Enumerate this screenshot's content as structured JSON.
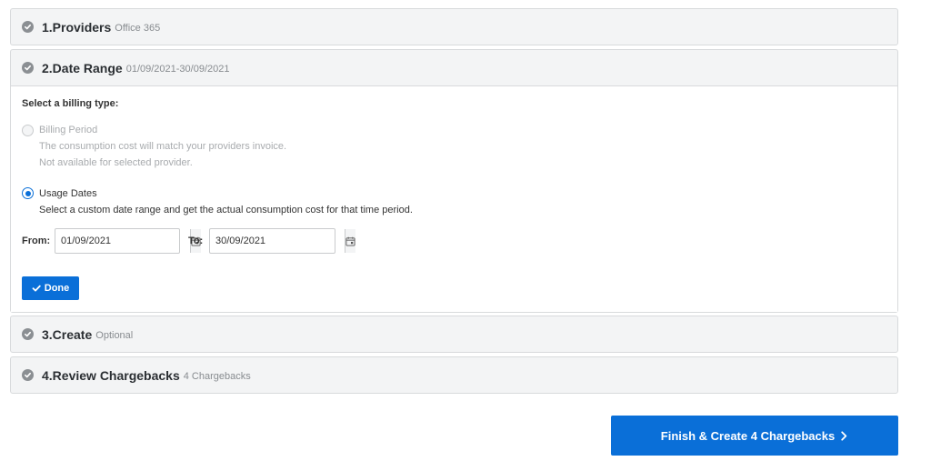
{
  "steps": [
    {
      "title": "1.Providers",
      "subtitle": "Office 365"
    },
    {
      "title": "2.Date Range",
      "subtitle": "01/09/2021-30/09/2021"
    },
    {
      "title": "3.Create",
      "subtitle": "Optional"
    },
    {
      "title": "4.Review Chargebacks",
      "subtitle": "4 Chargebacks"
    }
  ],
  "date_range": {
    "billing_type_label": "Select a billing type:",
    "billing_period": {
      "label": "Billing Period",
      "description": "The consumption cost will match your providers invoice.",
      "note": "Not available for selected provider.",
      "enabled": false
    },
    "usage_dates": {
      "label": "Usage Dates",
      "description": "Select a custom date range and get the actual consumption cost for that time period.",
      "selected": true
    },
    "from_label": "From:",
    "from_value": "01/09/2021",
    "to_label": "To:",
    "to_value": "30/09/2021",
    "done_label": "Done"
  },
  "finish_label": "Finish & Create 4 Chargebacks",
  "colors": {
    "primary": "#0a6fd8",
    "panel_bg": "#f3f4f5",
    "border": "#d8dadc",
    "muted_text": "#a8abae"
  },
  "icons": {
    "step_status": "check-circle-icon",
    "date_picker": "calendar-icon",
    "done": "checkmark-icon",
    "finish": "chevron-right-icon"
  }
}
